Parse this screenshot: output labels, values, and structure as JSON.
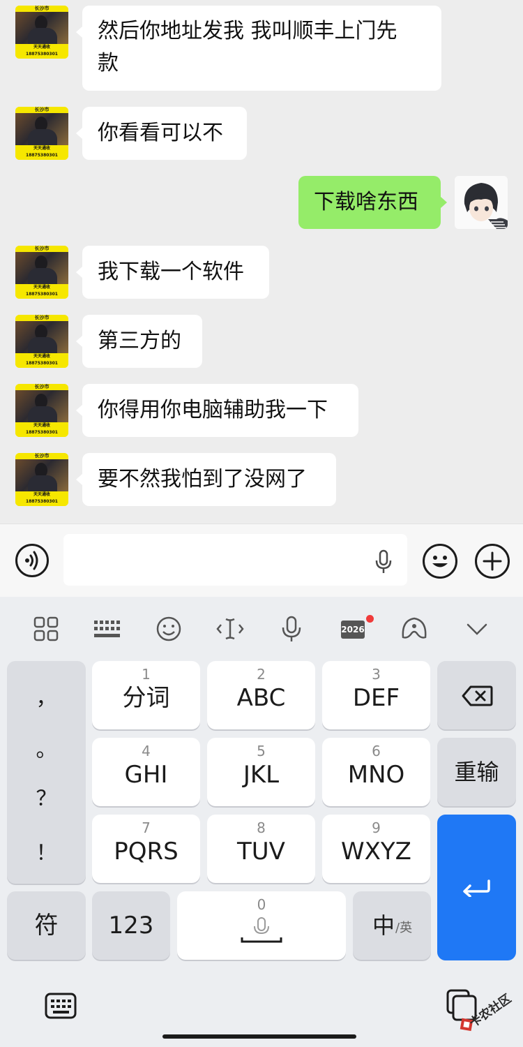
{
  "chat": {
    "left_avatar": {
      "top_text": "长沙市",
      "brand_text": "天天通收",
      "phone_text": "18875380301"
    },
    "messages": [
      {
        "side": "left",
        "text_line1": "然后你地址发我 我叫顺丰上门先",
        "text_line2": "款"
      },
      {
        "side": "left",
        "text": "你看看可以不"
      },
      {
        "side": "right",
        "text": "下载啥东西"
      },
      {
        "side": "left",
        "text": "我下载一个软件"
      },
      {
        "side": "left",
        "text": "第三方的"
      },
      {
        "side": "left",
        "text": "你得用你电脑辅助我一下"
      },
      {
        "side": "left",
        "text": "要不然我怕到了没网了"
      }
    ]
  },
  "input_bar": {
    "voice_icon": "voice-wave-icon",
    "mic_icon": "microphone-icon",
    "emoji_icon": "smiley-icon",
    "plus_icon": "plus-icon"
  },
  "ime": {
    "toolbar": [
      "grid-apps-icon",
      "keyboard-icon",
      "emoji-icon",
      "cursor-icon",
      "microphone-icon",
      "calendar-2026-icon",
      "skin-theme-icon",
      "collapse-chevron-icon"
    ],
    "calendar_label": "2026",
    "punctuation": [
      "，",
      "。",
      "？",
      "！"
    ],
    "keys": [
      {
        "num": "1",
        "label": "分词"
      },
      {
        "num": "2",
        "label": "ABC"
      },
      {
        "num": "3",
        "label": "DEF"
      },
      {
        "num": "4",
        "label": "GHI"
      },
      {
        "num": "5",
        "label": "JKL"
      },
      {
        "num": "6",
        "label": "MNO"
      },
      {
        "num": "7",
        "label": "PQRS"
      },
      {
        "num": "8",
        "label": "TUV"
      },
      {
        "num": "9",
        "label": "WXYZ"
      }
    ],
    "reinput_label": "重输",
    "symbol_label": "符",
    "num_label": "123",
    "space_num": "0",
    "lang_main": "中",
    "lang_sub": "/英",
    "accent_color": "#1f78f5",
    "bubble_self_color": "#95ec69"
  },
  "watermark": {
    "text": "卡农社区"
  }
}
